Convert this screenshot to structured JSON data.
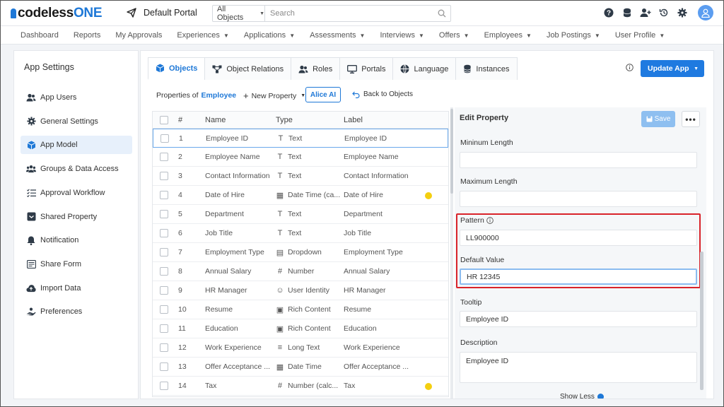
{
  "app": {
    "logo_prefix": "codeless",
    "logo_suffix": "ONE",
    "portal_name": "Default Portal"
  },
  "search": {
    "scope": "All Objects",
    "placeholder": "Search"
  },
  "menu": [
    "Dashboard",
    "Reports",
    "My Approvals",
    "Experiences",
    "Applications",
    "Assessments",
    "Interviews",
    "Offers",
    "Employees",
    "Job Postings",
    "User Profile"
  ],
  "sidebar": {
    "title": "App Settings",
    "items": [
      {
        "label": "App Users",
        "icon": "users-icon"
      },
      {
        "label": "General Settings",
        "icon": "gear-icon"
      },
      {
        "label": "App Model",
        "icon": "cube-icon",
        "active": true
      },
      {
        "label": "Groups & Data Access",
        "icon": "group-icon"
      },
      {
        "label": "Approval Workflow",
        "icon": "list-check-icon"
      },
      {
        "label": "Shared Property",
        "icon": "box-icon"
      },
      {
        "label": "Notification",
        "icon": "bell-icon"
      },
      {
        "label": "Share Form",
        "icon": "form-icon"
      },
      {
        "label": "Import Data",
        "icon": "cloud-upload-icon"
      },
      {
        "label": "Preferences",
        "icon": "hand-icon"
      }
    ]
  },
  "tabs": [
    {
      "label": "Objects",
      "icon": "cube-icon"
    },
    {
      "label": "Object Relations",
      "icon": "relations-icon"
    },
    {
      "label": "Roles",
      "icon": "users-icon"
    },
    {
      "label": "Portals",
      "icon": "monitor-icon"
    },
    {
      "label": "Language",
      "icon": "globe-icon"
    },
    {
      "label": "Instances",
      "icon": "database-icon"
    }
  ],
  "toolbar": {
    "update_label": "Update App",
    "properties_of": "Properties of",
    "object_name": "Employee",
    "new_property": "New Property",
    "alice": "Alice AI",
    "back": "Back to Objects"
  },
  "table": {
    "headers": [
      "#",
      "Name",
      "Type",
      "Label"
    ],
    "rows": [
      {
        "num": "1",
        "name": "Employee ID",
        "type": "Text",
        "tic": "T",
        "label": "Employee ID",
        "dot": false
      },
      {
        "num": "2",
        "name": "Employee Name",
        "type": "Text",
        "tic": "T",
        "label": "Employee Name",
        "dot": false
      },
      {
        "num": "3",
        "name": "Contact Information",
        "type": "Text",
        "tic": "T",
        "label": "Contact Information",
        "dot": false
      },
      {
        "num": "4",
        "name": "Date of Hire",
        "type": "Date Time (ca...",
        "tic": "▦",
        "label": "Date of Hire",
        "dot": true
      },
      {
        "num": "5",
        "name": "Department",
        "type": "Text",
        "tic": "T",
        "label": "Department",
        "dot": false
      },
      {
        "num": "6",
        "name": "Job Title",
        "type": "Text",
        "tic": "T",
        "label": "Job Title",
        "dot": false
      },
      {
        "num": "7",
        "name": "Employment Type",
        "type": "Dropdown",
        "tic": "▤",
        "label": "Employment Type",
        "dot": false
      },
      {
        "num": "8",
        "name": "Annual Salary",
        "type": "Number",
        "tic": "#",
        "label": "Annual Salary",
        "dot": false
      },
      {
        "num": "9",
        "name": "HR Manager",
        "type": "User Identity",
        "tic": "☺",
        "label": "HR Manager",
        "dot": false
      },
      {
        "num": "10",
        "name": "Resume",
        "type": "Rich Content",
        "tic": "▣",
        "label": "Resume",
        "dot": false
      },
      {
        "num": "11",
        "name": "Education",
        "type": "Rich Content",
        "tic": "▣",
        "label": "Education",
        "dot": false
      },
      {
        "num": "12",
        "name": "Work Experience",
        "type": "Long Text",
        "tic": "≡",
        "label": "Work Experience",
        "dot": false
      },
      {
        "num": "13",
        "name": "Offer Acceptance ...",
        "type": "Date Time",
        "tic": "▦",
        "label": "Offer Acceptance ...",
        "dot": false
      },
      {
        "num": "14",
        "name": "Tax",
        "type": "Number (calc...",
        "tic": "#",
        "label": "Tax",
        "dot": true
      }
    ]
  },
  "panel": {
    "title": "Edit Property",
    "save": "Save",
    "min_label": "Mininum Length",
    "min_value": "",
    "max_label": "Maximum Length",
    "max_value": "",
    "pattern_label": "Pattern",
    "pattern_value": "LL900000",
    "default_label": "Default Value",
    "default_value": "HR 12345",
    "tooltip_label": "Tooltip",
    "tooltip_value": "Employee ID",
    "desc_label": "Description",
    "desc_value": "Employee ID",
    "show_less": "Show Less"
  }
}
